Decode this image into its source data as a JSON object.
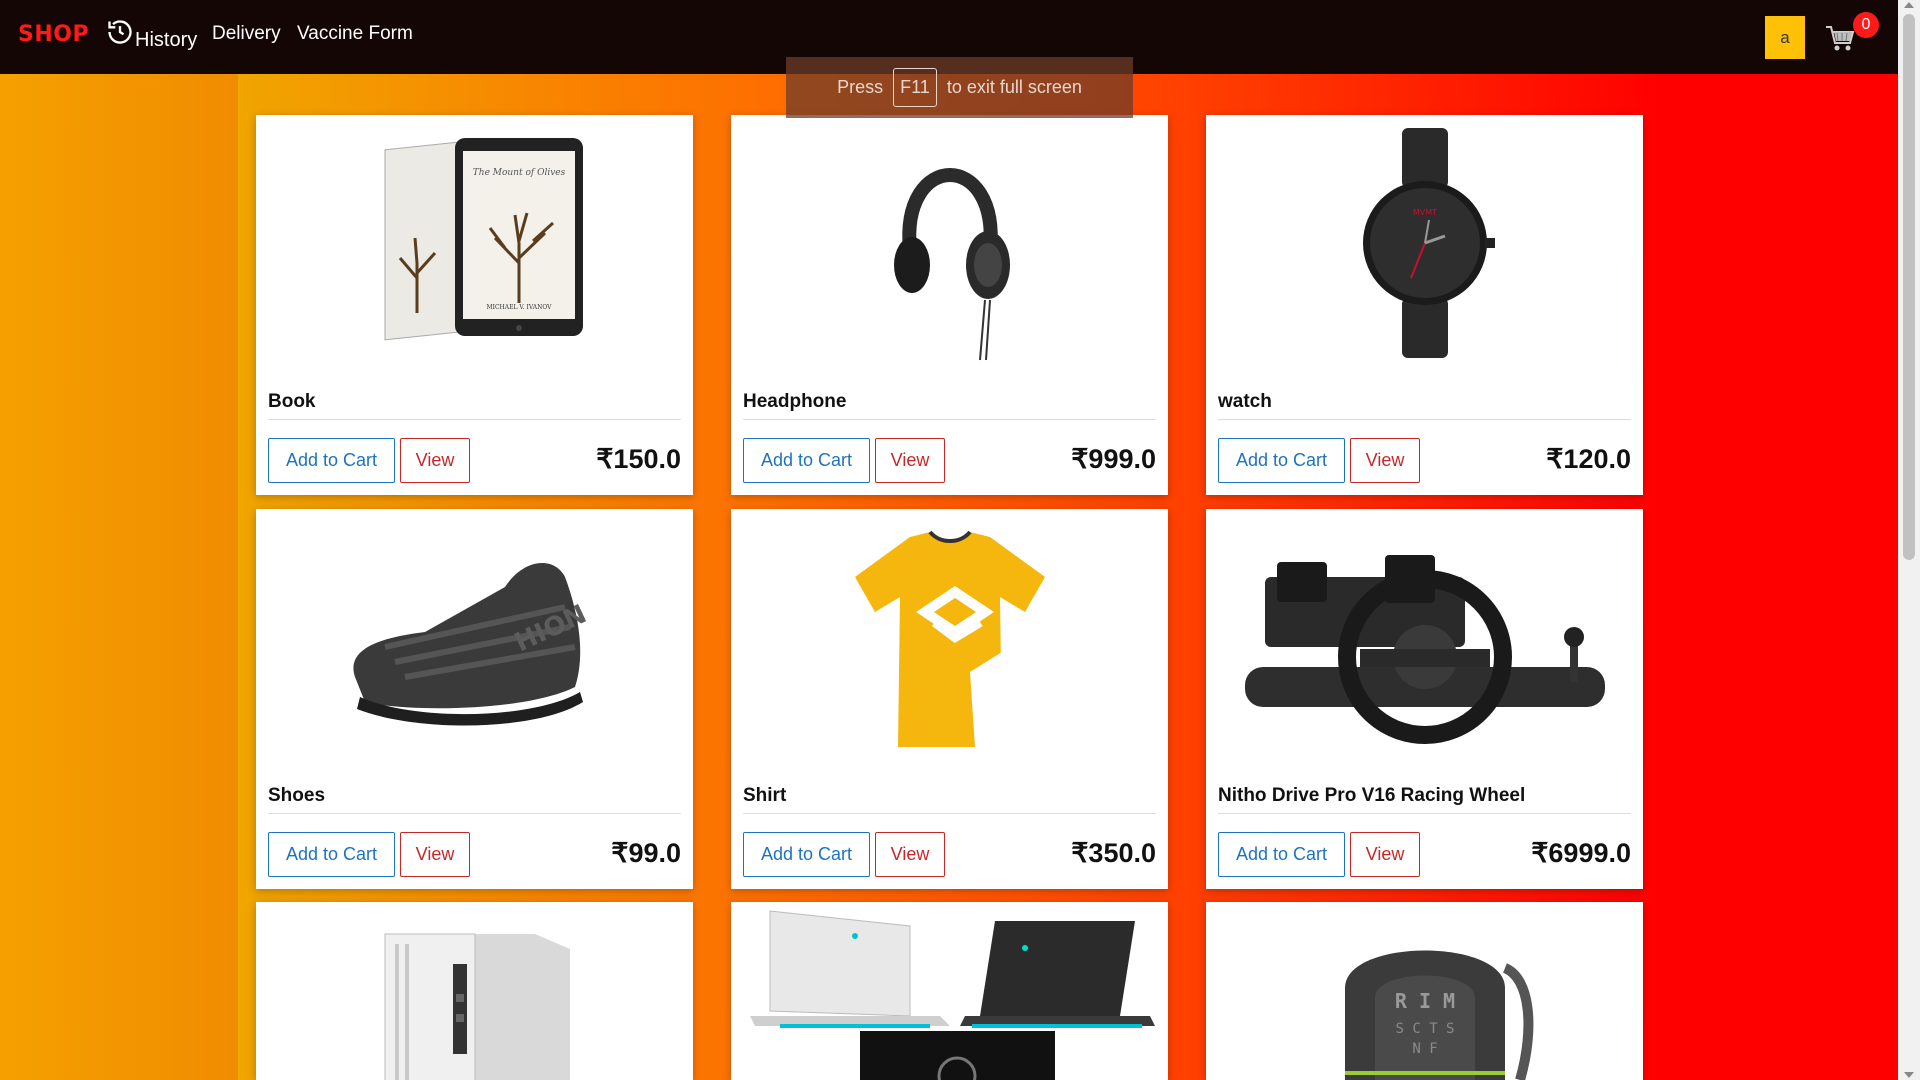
{
  "navbar": {
    "brand": "SHOP",
    "history_label": "History",
    "delivery_label": "Delivery",
    "vaccine_label": "Vaccine Form",
    "avatar_letter": "a",
    "cart_count": "0"
  },
  "toast": {
    "before": "Press",
    "key": "F11",
    "after": "to exit full screen"
  },
  "products": [
    {
      "name": "Book",
      "price": "₹150.0",
      "add_label": "Add to Cart",
      "view_label": "View",
      "image": "book-image"
    },
    {
      "name": "Headphone",
      "price": "₹999.0",
      "add_label": "Add to Cart",
      "view_label": "View",
      "image": "headphone-image"
    },
    {
      "name": "watch",
      "price": "₹120.0",
      "add_label": "Add to Cart",
      "view_label": "View",
      "image": "watch-image"
    },
    {
      "name": "Shoes",
      "price": "₹99.0",
      "add_label": "Add to Cart",
      "view_label": "View",
      "image": "shoe-image"
    },
    {
      "name": "Shirt",
      "price": "₹350.0",
      "add_label": "Add to Cart",
      "view_label": "View",
      "image": "shirt-image"
    },
    {
      "name": "Nitho Drive Pro V16 Racing Wheel",
      "price": "₹6999.0",
      "add_label": "Add to Cart",
      "view_label": "View",
      "image": "racing-wheel-image"
    },
    {
      "image": "desktop-pc-image"
    },
    {
      "image": "laptop-image"
    },
    {
      "image": "backpack-image"
    }
  ],
  "colors": {
    "navbar_bg": "#130604",
    "brand": "#ff1a1a",
    "add_to_cart": "#1e73be",
    "view": "#c62828",
    "avatar_bg": "#ffc107",
    "badge_bg": "#ff1a1a"
  }
}
